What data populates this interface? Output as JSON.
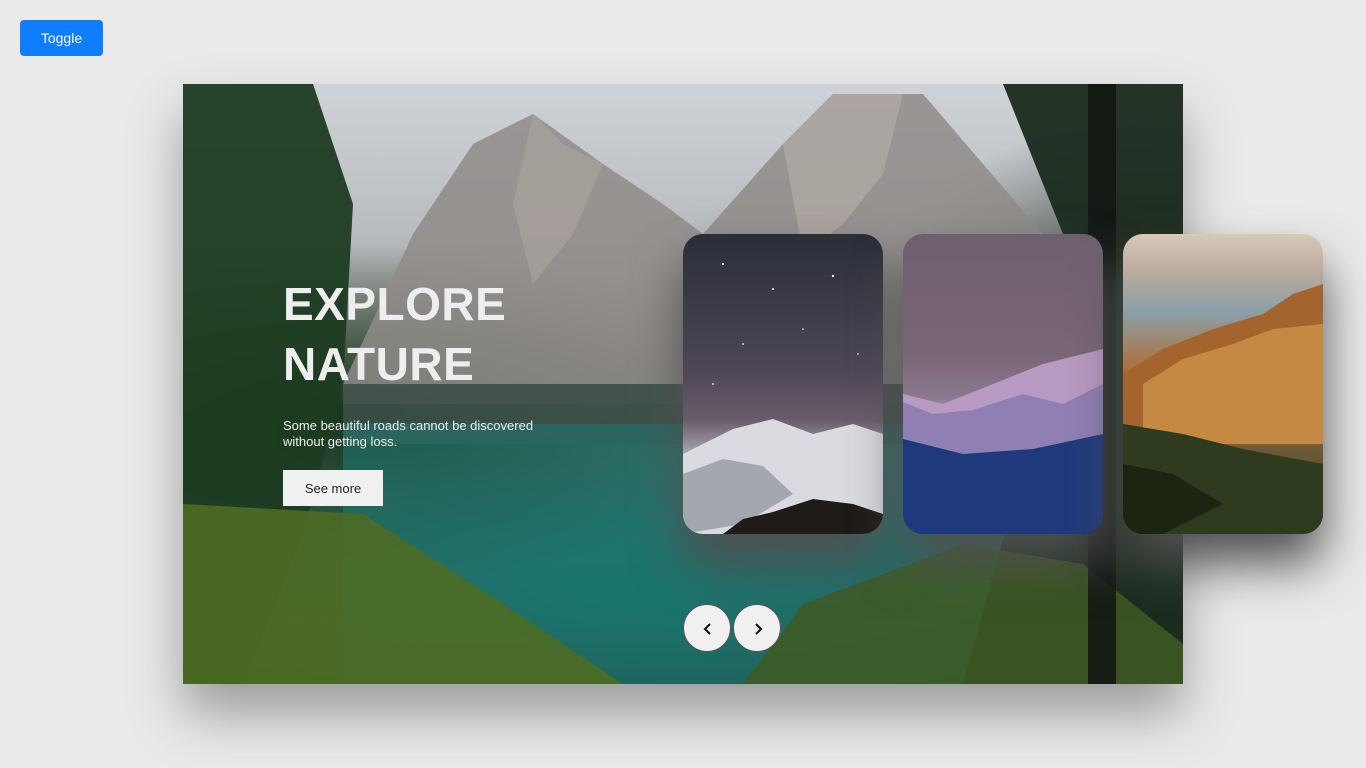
{
  "toolbar": {
    "toggle_label": "Toggle",
    "accent_color": "#0d7eff"
  },
  "hero": {
    "title": "EXPLORE\nNATURE",
    "description": "Some beautiful roads cannot be discovered without getting loss.",
    "cta_label": "See more"
  },
  "cards": [
    {
      "scene": "starry night sky over snowy mountains"
    },
    {
      "scene": "pink-lit snowy peaks under purple dusk sky"
    },
    {
      "scene": "sunlit golden cliffs above the sea"
    }
  ],
  "nav": {
    "prev_icon": "chevron-left-icon",
    "next_icon": "chevron-right-icon"
  }
}
